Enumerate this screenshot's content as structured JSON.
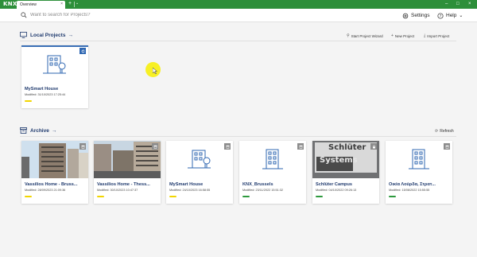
{
  "titlebar": {
    "logo": "KNX",
    "tab_label": "Overview",
    "tab_close": "×",
    "add_tab": "+",
    "tab_menu": "⌄",
    "minimize": "–",
    "maximize": "□",
    "close": "×"
  },
  "toolbar": {
    "search_placeholder": "Want to search for Projects?",
    "settings_label": "Settings",
    "help_label": "Help"
  },
  "local": {
    "heading": "Local Projects",
    "arrow": "→",
    "actions": {
      "wizard": "Start Project Wizard",
      "new": "New Project",
      "import": "Import Project"
    },
    "cards": [
      {
        "title": "MySmart House",
        "modified": "Modified: 31/10/2023 17:25:44",
        "tag_color": "#f2d500"
      }
    ]
  },
  "archive": {
    "heading": "Archive",
    "arrow": "→",
    "refresh_label": "Refresh",
    "cards": [
      {
        "title": "Vassilios Home - Bruss...",
        "modified": "Modified: 28/09/2023 21:09:36",
        "tag_color": "#f2d500",
        "image": "photo-building"
      },
      {
        "title": "Vassilios Home - Thess...",
        "modified": "Modified: 30/10/2023 10:47:37",
        "tag_color": "#f2d500",
        "image": "photo-street"
      },
      {
        "title": "MySmart House",
        "modified": "Modified: 24/10/2023 16:58:55",
        "tag_color": "#f2d500",
        "image": "house-icon"
      },
      {
        "title": "KNX_Brussels",
        "modified": "Modified: 23/11/2022 15:51:32",
        "tag_color": "#2e9a3e",
        "image": "building-icon"
      },
      {
        "title": "Schlüter Campus",
        "modified": "Modified: 04/10/2022 09:26:13",
        "tag_color": "#2e9a3e",
        "image": "photo-sign",
        "sign_line1": "Schlüter",
        "sign_line2": "Systems"
      },
      {
        "title": "Οικία Λούρδα, Στρατ...",
        "modified": "Modified: 15/08/2022 15:55:55",
        "tag_color": "#2e9a3e",
        "image": "building-icon"
      }
    ]
  },
  "colors": {
    "brand_green": "#2d8f3a",
    "accent_blue": "#2f67b2",
    "tag_yellow": "#f2d500",
    "tag_green": "#2e9a3e"
  }
}
